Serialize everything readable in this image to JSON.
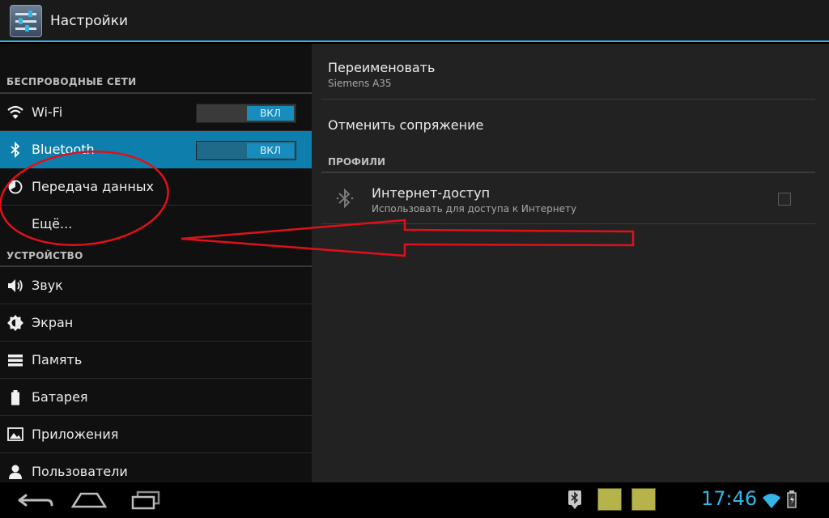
{
  "app": {
    "title": "Настройки"
  },
  "sidebar": {
    "sections": [
      {
        "header": "БЕСПРОВОДНЫЕ СЕТИ"
      },
      {
        "header": "УСТРОЙСТВО"
      }
    ],
    "items": [
      {
        "label": "Wi-Fi",
        "icon": "wifi-icon",
        "toggle": "ВКЛ"
      },
      {
        "label": "Bluetooth",
        "icon": "bluetooth-icon",
        "toggle": "ВКЛ",
        "selected": true
      },
      {
        "label": "Передача данных",
        "icon": "data-usage-icon"
      },
      {
        "label": "Ещё...",
        "icon": ""
      },
      {
        "label": "Звук",
        "icon": "volume-icon"
      },
      {
        "label": "Экран",
        "icon": "brightness-icon"
      },
      {
        "label": "Память",
        "icon": "storage-icon"
      },
      {
        "label": "Батарея",
        "icon": "battery-icon"
      },
      {
        "label": "Приложения",
        "icon": "apps-icon"
      },
      {
        "label": "Пользователи",
        "icon": "users-icon"
      }
    ]
  },
  "detail": {
    "rename": {
      "title": "Переименовать",
      "subtitle": "Siemens A35"
    },
    "unpair": {
      "title": "Отменить сопряжение"
    },
    "profiles_header": "ПРОФИЛИ",
    "profile": {
      "title": "Интернет-доступ",
      "subtitle": "Использовать для доступа к Интернету",
      "checked": false
    }
  },
  "statusbar": {
    "time": "17:46",
    "notifications": [
      "gsm-notification-icon",
      "gsm-notification-icon"
    ]
  },
  "colors": {
    "accent": "#33b5e5",
    "selected": "#0e7fac",
    "annotation": "#e0101a"
  }
}
